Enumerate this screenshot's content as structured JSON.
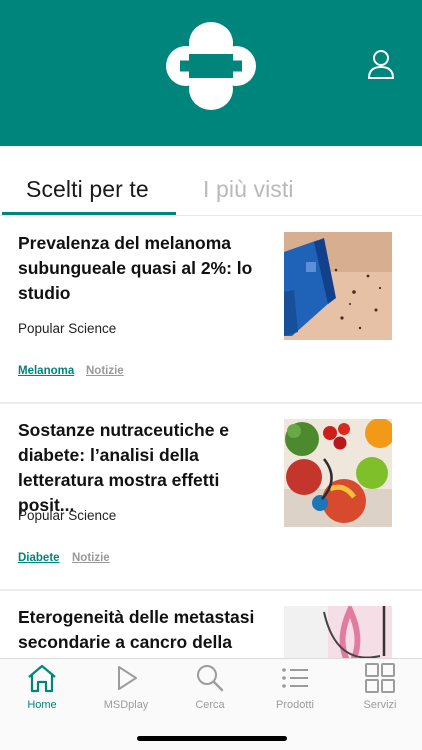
{
  "header": {
    "brand_color": "#00857c",
    "logo_icon": "msd-logo-icon",
    "profile_icon": "user-icon"
  },
  "tabs": [
    {
      "label": "Scelti per te",
      "active": true
    },
    {
      "label": "I più visti",
      "active": false
    }
  ],
  "articles": [
    {
      "title": "Prevalenza del melanoma subungueale quasi al 2%: lo studio",
      "source": "Popular Science",
      "tags": [
        "Melanoma",
        "Notizie"
      ],
      "image": "dermatoscope-skin-photo"
    },
    {
      "title": "Sostanze nutraceutiche e diabete: l’analisi della letteratura mostra effetti posit...",
      "source": "Popular Science",
      "tags": [
        "Diabete",
        "Notizie"
      ],
      "image": "fruit-vegetables-stethoscope-photo"
    },
    {
      "title": "Eterogeneità delle metastasi secondarie a cancro della",
      "image": "pink-ribbon-stethoscope-photo"
    }
  ],
  "tabbar": [
    {
      "label": "Home",
      "icon": "home-icon",
      "active": true
    },
    {
      "label": "MSDplay",
      "icon": "play-icon",
      "active": false
    },
    {
      "label": "Cerca",
      "icon": "search-icon",
      "active": false
    },
    {
      "label": "Prodotti",
      "icon": "list-icon",
      "active": false
    },
    {
      "label": "Servizi",
      "icon": "grid-icon",
      "active": false
    }
  ]
}
